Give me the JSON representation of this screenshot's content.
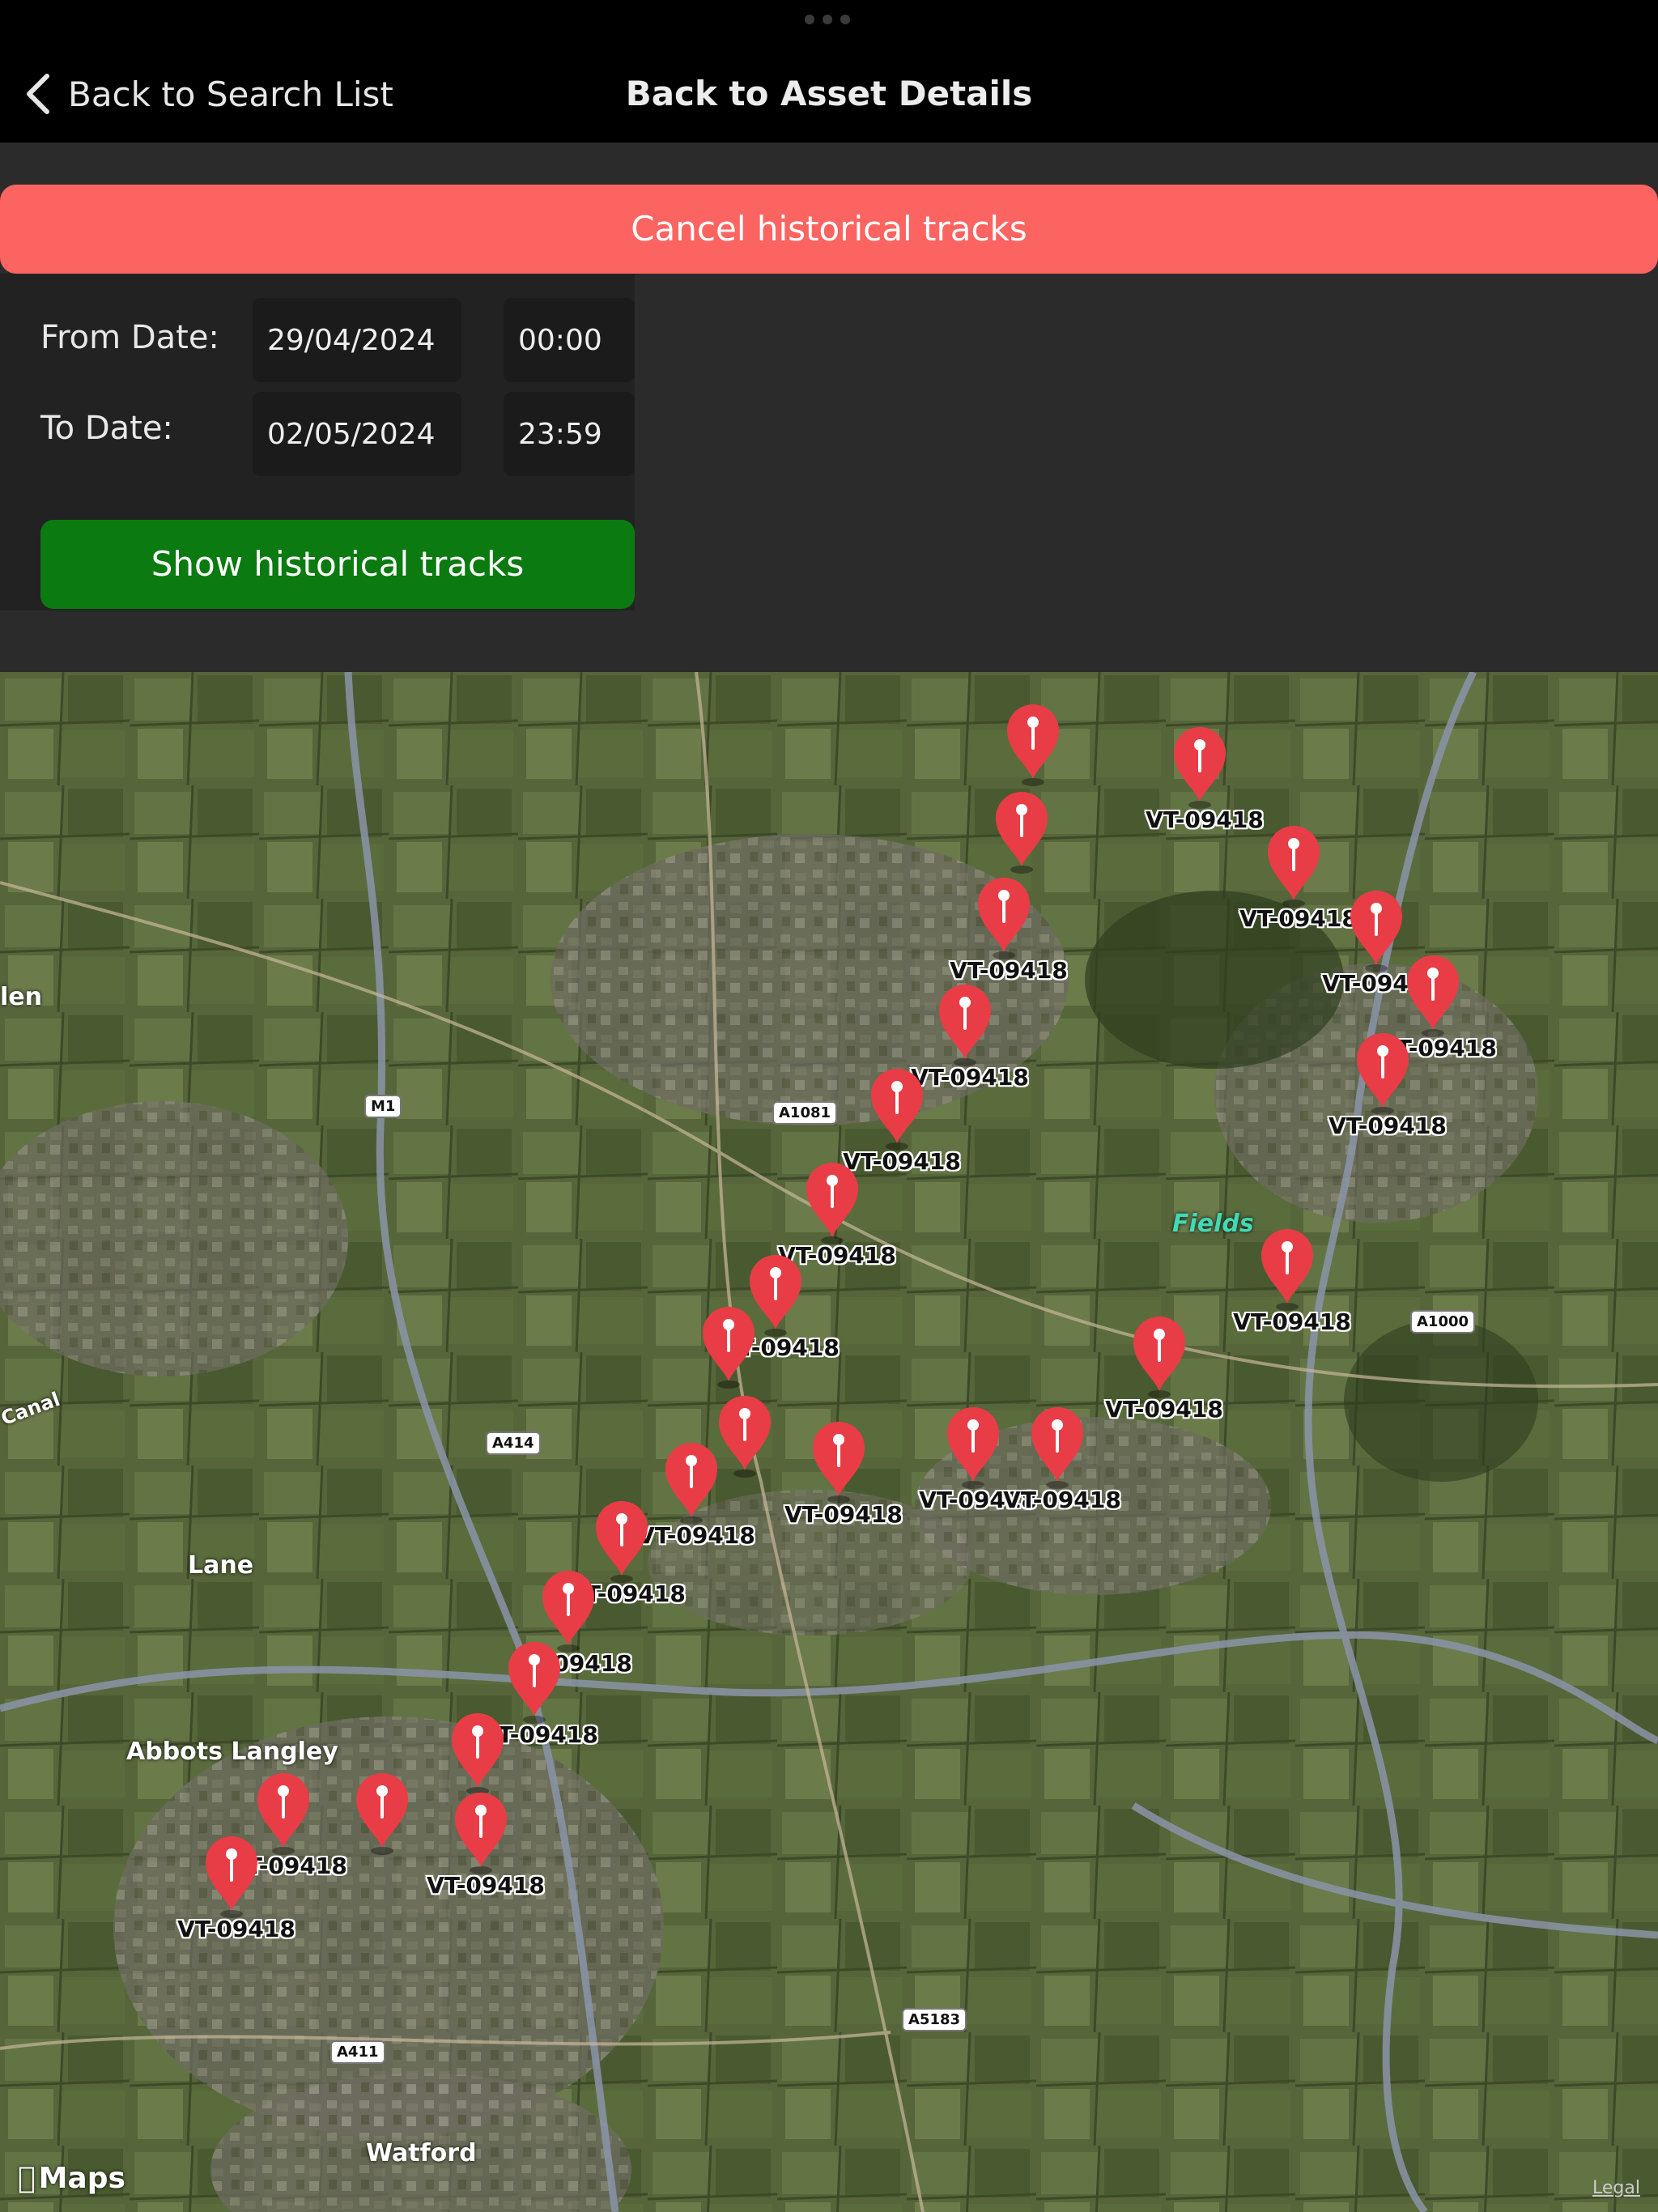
{
  "header": {
    "back_label": "Back to Search List",
    "title": "Back to Asset Details"
  },
  "cancel_label": "Cancel historical tracks",
  "dates": {
    "from_label": "From Date:",
    "from_date": "29/04/2024",
    "from_time": "00:00",
    "to_label": "To Date:",
    "to_date": "02/05/2024",
    "to_time": "23:59"
  },
  "show_label": "Show historical tracks",
  "map": {
    "marker_label": "VT-09418",
    "places": [
      "len",
      "Lane",
      "Abbots Langley",
      "Watford",
      "Fields",
      "Canal"
    ],
    "roads": [
      "M1",
      "A1081",
      "A414",
      "A1000",
      "A411",
      "A5183"
    ],
    "attribution": "Maps",
    "legal": "Legal"
  },
  "colors": {
    "cancel": "#fc6461",
    "show": "#0b7a11",
    "marker": "#e83d46"
  }
}
